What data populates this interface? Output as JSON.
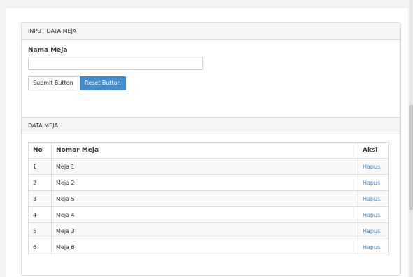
{
  "input_panel": {
    "title": "INPUT DATA MEJA",
    "field_label": "Nama Meja",
    "field_value": "",
    "submit_label": "Submit Button",
    "reset_label": "Reset Button"
  },
  "data_panel": {
    "title": "DATA MEJA",
    "headers": {
      "no": "No",
      "nomor_meja": "Nomor Meja",
      "aksi": "Aksi"
    },
    "rows": [
      {
        "no": "1",
        "nama": "Meja 1",
        "aksi": "Hapus"
      },
      {
        "no": "2",
        "nama": "Meja 2",
        "aksi": "Hapus"
      },
      {
        "no": "3",
        "nama": "Meja 5",
        "aksi": "Hapus"
      },
      {
        "no": "4",
        "nama": "Meja 4",
        "aksi": "Hapus"
      },
      {
        "no": "5",
        "nama": "Meja 3",
        "aksi": "Hapus"
      },
      {
        "no": "6",
        "nama": "Meja 6",
        "aksi": "Hapus"
      }
    ]
  },
  "colors": {
    "primary": "#428bca",
    "link": "#428bca",
    "panel_heading_bg": "#f5f5f5"
  }
}
